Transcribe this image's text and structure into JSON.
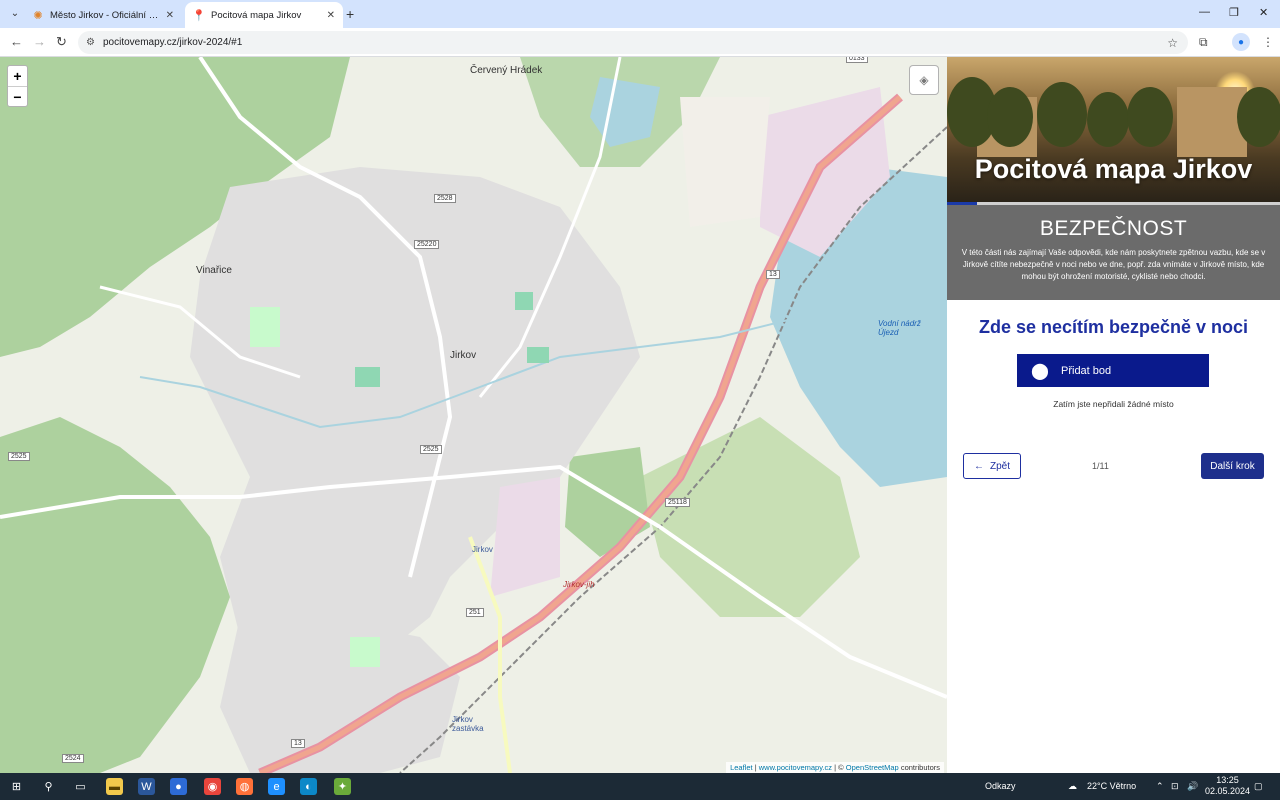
{
  "browser": {
    "tabs": [
      {
        "title": "Město Jirkov - Oficiální stránky",
        "icon": "sun-favicon-icon"
      },
      {
        "title": "Pocitová mapa Jirkov",
        "icon": "map-pin-favicon-icon"
      }
    ],
    "url": "pocitovemapy.cz/jirkov-2024/#1"
  },
  "map": {
    "zoom_in": "+",
    "zoom_out": "−",
    "labels": {
      "cerveny_hradek": "Červený Hrádek",
      "vinarice": "Vinařice",
      "jirkov": "Jirkov",
      "vodni_nadrz": "Vodní nádrž Újezd",
      "jirkov_station": "Jirkov",
      "jirkov_zastavka": "Jirkov zastávka",
      "jirkov_jih": "Jirkov-jih"
    },
    "shields": [
      "25220",
      "2528",
      "2525",
      "2525",
      "25118",
      "251",
      "13",
      "13",
      "2524",
      "0133"
    ],
    "attribution": {
      "leaflet": "Leaflet",
      "site": "www.pocitovemapy.cz",
      "copyright": "© ",
      "osm": "OpenStreetMap",
      "contributors": " contributors"
    }
  },
  "panel": {
    "hero_title": "Pocitová mapa Jirkov",
    "progress_fraction": 0.0909,
    "section_title": "BEZPEČNOST",
    "section_text": "V této části nás zajímají Vaše odpovědi, kde nám poskytnete zpětnou vazbu, kde se v Jirkově cítíte nebezpečně v noci nebo ve dne, popř. zda vnímáte v Jirkově místo, kde mohou být ohrožení motoristé, cyklisté nebo chodci.",
    "question": "Zde se necítím bezpečně v noci",
    "add_point": "Přidat bod",
    "hint": "Zatím jste nepřidali žádné místo",
    "back": "Zpět",
    "step": "1/11",
    "next": "Další krok"
  },
  "taskbar": {
    "links": "Odkazy",
    "weather": "22°C  Větrno",
    "time": "13:25",
    "date": "02.05.2024"
  },
  "colors": {
    "accent": "#1e2fa0",
    "button": "#0a1a8c",
    "section_bg": "#6b6b6b"
  }
}
